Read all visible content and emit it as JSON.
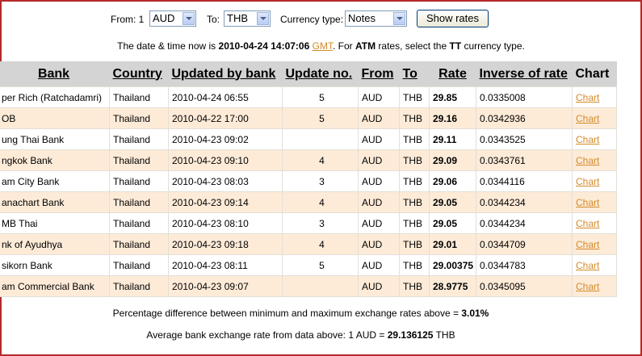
{
  "controls": {
    "from_label": "From: 1",
    "from_currency": "AUD",
    "to_label": "To:",
    "to_currency": "THB",
    "currency_type_label": "Currency type:",
    "currency_type": "Notes",
    "show_button": "Show rates"
  },
  "info": {
    "prefix": "The date & time now is ",
    "datetime": "2010-04-24 14:07:06",
    "gmt": "GMT",
    "mid": ". For ",
    "atm": "ATM",
    "mid2": " rates, select the ",
    "tt": "TT",
    "suffix": " currency type."
  },
  "table": {
    "headers": {
      "bank": "Bank",
      "country": "Country",
      "updated": "Updated by bank",
      "update_no": "Update no.",
      "from": "From",
      "to": "To",
      "rate": "Rate",
      "inverse": "Inverse of rate",
      "chart": "Chart"
    },
    "rows": [
      {
        "bank": "per Rich (Ratchadamri)",
        "country": "Thailand",
        "updated": "2010-04-24 06:55",
        "update_no": "5",
        "from": "AUD",
        "to": "THB",
        "rate": "29.85",
        "inverse": "0.0335008",
        "chart": "Chart"
      },
      {
        "bank": "OB",
        "country": "Thailand",
        "updated": "2010-04-22 17:00",
        "update_no": "5",
        "from": "AUD",
        "to": "THB",
        "rate": "29.16",
        "inverse": "0.0342936",
        "chart": "Chart"
      },
      {
        "bank": "ung Thai Bank",
        "country": "Thailand",
        "updated": "2010-04-23 09:02",
        "update_no": "",
        "from": "AUD",
        "to": "THB",
        "rate": "29.11",
        "inverse": "0.0343525",
        "chart": "Chart"
      },
      {
        "bank": "ngkok Bank",
        "country": "Thailand",
        "updated": "2010-04-23 09:10",
        "update_no": "4",
        "from": "AUD",
        "to": "THB",
        "rate": "29.09",
        "inverse": "0.0343761",
        "chart": "Chart"
      },
      {
        "bank": "am City Bank",
        "country": "Thailand",
        "updated": "2010-04-23 08:03",
        "update_no": "3",
        "from": "AUD",
        "to": "THB",
        "rate": "29.06",
        "inverse": "0.0344116",
        "chart": "Chart"
      },
      {
        "bank": "anachart Bank",
        "country": "Thailand",
        "updated": "2010-04-23 09:14",
        "update_no": "4",
        "from": "AUD",
        "to": "THB",
        "rate": "29.05",
        "inverse": "0.0344234",
        "chart": "Chart"
      },
      {
        "bank": "MB Thai",
        "country": "Thailand",
        "updated": "2010-04-23 08:10",
        "update_no": "3",
        "from": "AUD",
        "to": "THB",
        "rate": "29.05",
        "inverse": "0.0344234",
        "chart": "Chart"
      },
      {
        "bank": "nk of Ayudhya",
        "country": "Thailand",
        "updated": "2010-04-23 09:18",
        "update_no": "4",
        "from": "AUD",
        "to": "THB",
        "rate": "29.01",
        "inverse": "0.0344709",
        "chart": "Chart"
      },
      {
        "bank": "sikorn Bank",
        "country": "Thailand",
        "updated": "2010-04-23 08:11",
        "update_no": "5",
        "from": "AUD",
        "to": "THB",
        "rate": "29.00375",
        "inverse": "0.0344783",
        "chart": "Chart"
      },
      {
        "bank": "am Commercial Bank",
        "country": "Thailand",
        "updated": "2010-04-23 09:07",
        "update_no": "",
        "from": "AUD",
        "to": "THB",
        "rate": "28.9775",
        "inverse": "0.0345095",
        "chart": "Chart"
      }
    ]
  },
  "summary": {
    "pct_text": "Percentage difference between minimum and maximum exchange rates above = ",
    "pct_value": "3.01%",
    "avg_text": "Average bank exchange rate from data above: 1 AUD = ",
    "avg_value": "29.136125",
    "avg_unit": " THB"
  },
  "colors": {
    "frame": "#b52b2b",
    "header_bg": "#d4d4d4",
    "row_alt": "#fdebd8",
    "link": "#d58a28"
  }
}
